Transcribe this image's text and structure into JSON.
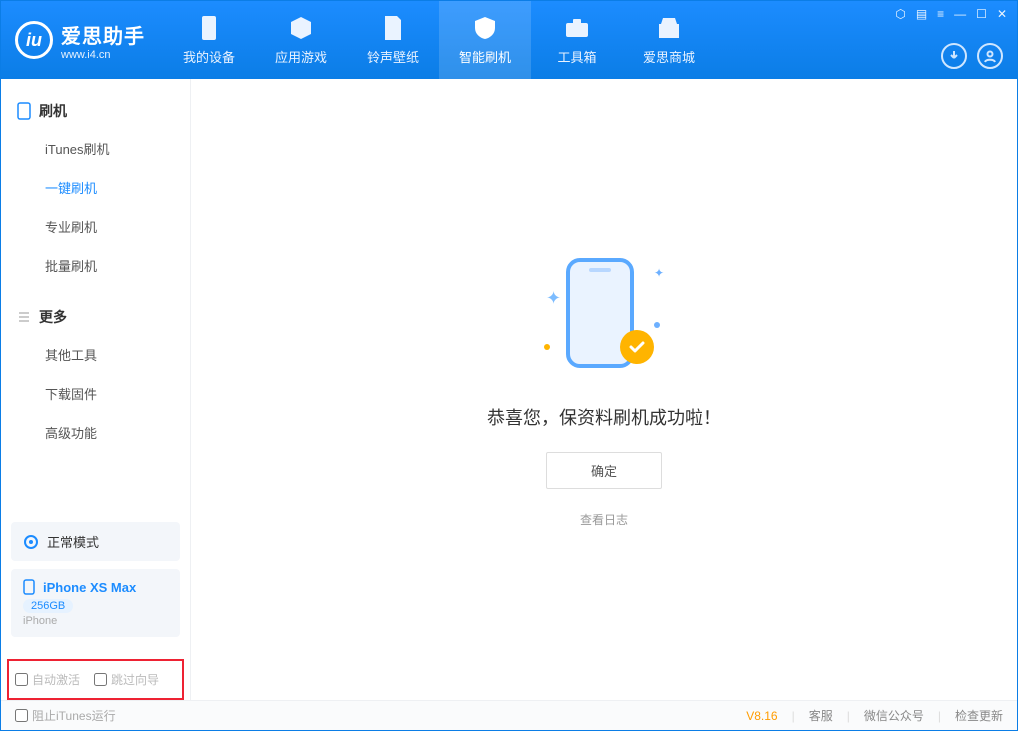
{
  "app": {
    "name_cn": "爱思助手",
    "url": "www.i4.cn"
  },
  "header_tabs": [
    {
      "label": "我的设备"
    },
    {
      "label": "应用游戏"
    },
    {
      "label": "铃声壁纸"
    },
    {
      "label": "智能刷机",
      "active": true
    },
    {
      "label": "工具箱"
    },
    {
      "label": "爱思商城"
    }
  ],
  "sidebar": {
    "group1_title": "刷机",
    "group1_items": [
      "iTunes刷机",
      "一键刷机",
      "专业刷机",
      "批量刷机"
    ],
    "group1_active_index": 1,
    "group2_title": "更多",
    "group2_items": [
      "其他工具",
      "下载固件",
      "高级功能"
    ]
  },
  "device_mode": {
    "label": "正常模式"
  },
  "device": {
    "model": "iPhone XS Max",
    "capacity": "256GB",
    "subtype": "iPhone"
  },
  "options": {
    "auto_activate": "自动激活",
    "skip_guide": "跳过向导"
  },
  "main": {
    "success": "恭喜您，保资料刷机成功啦！",
    "ok": "确定",
    "view_log": "查看日志"
  },
  "footer": {
    "block_itunes": "阻止iTunes运行",
    "version": "V8.16",
    "links": [
      "客服",
      "微信公众号",
      "检查更新"
    ]
  }
}
